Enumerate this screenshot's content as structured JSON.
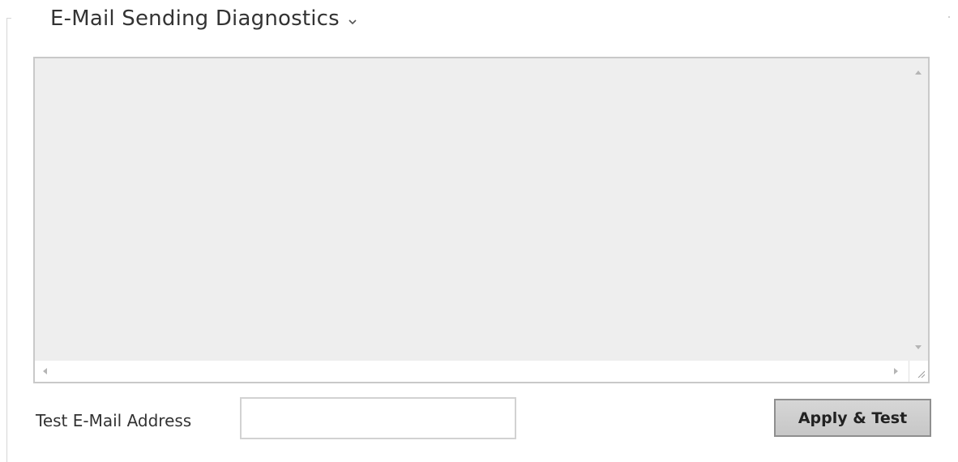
{
  "section": {
    "title": "E-Mail Sending Diagnostics",
    "collapse_icon": "chevron-down-icon"
  },
  "diagnostics_log": {
    "content": ""
  },
  "test_email": {
    "label": "Test E-Mail Address",
    "value": "",
    "placeholder": ""
  },
  "actions": {
    "apply_test_label": "Apply & Test"
  }
}
